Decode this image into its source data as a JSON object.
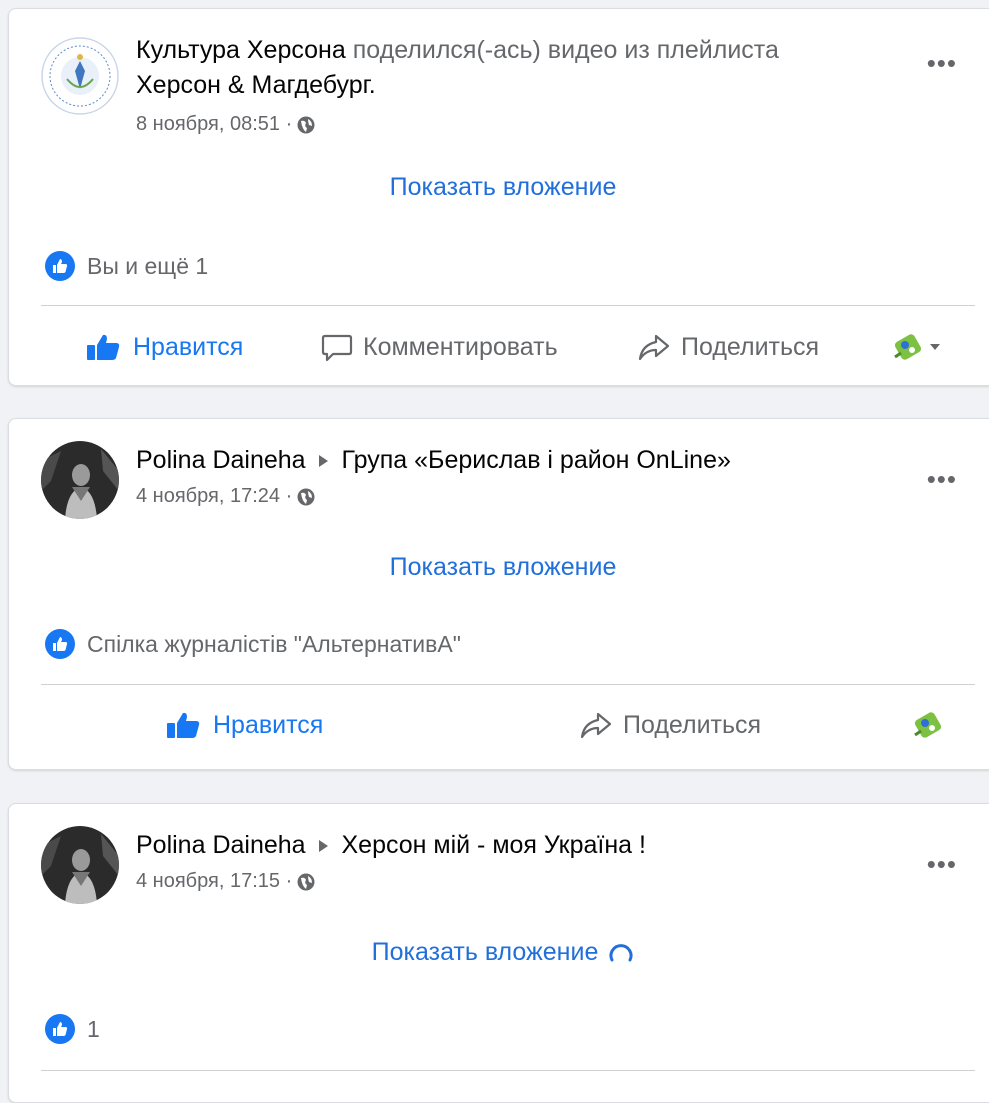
{
  "posts": [
    {
      "author": "Культура Херсона",
      "action_text": "поделился(-ась) видео из плейлиста",
      "target": "Херсон & Магдебург.",
      "time": "8 ноября, 08:51 ·",
      "show_attachment": "Показать вложение",
      "reactions_text": "Вы и ещё 1",
      "actions": {
        "like": "Нравится",
        "comment": "Комментировать",
        "share": "Поделиться"
      }
    },
    {
      "author": "Polina Daineha",
      "target": "Група «Берислав і район OnLine»",
      "time": "4 ноября, 17:24 ·",
      "show_attachment": "Показать вложение",
      "reactions_text": "Спілка журналістів \"АльтернативА\"",
      "actions": {
        "like": "Нравится",
        "share": "Поделиться"
      }
    },
    {
      "author": "Polina Daineha",
      "target": "Херсон мій - моя Україна !",
      "time": "4 ноября, 17:15 ·",
      "show_attachment": "Показать вложение",
      "reactions_text": "1"
    }
  ],
  "more_label": "•••",
  "colors": {
    "link": "#216fdb",
    "like_blue": "#1877f2",
    "muted": "#65676b"
  },
  "icons": [
    "more-options-icon",
    "globe-icon",
    "like-badge-icon",
    "thumbs-up-icon",
    "comment-icon",
    "share-icon",
    "sticker-icon",
    "caret-down-icon",
    "loading-spinner-icon"
  ]
}
